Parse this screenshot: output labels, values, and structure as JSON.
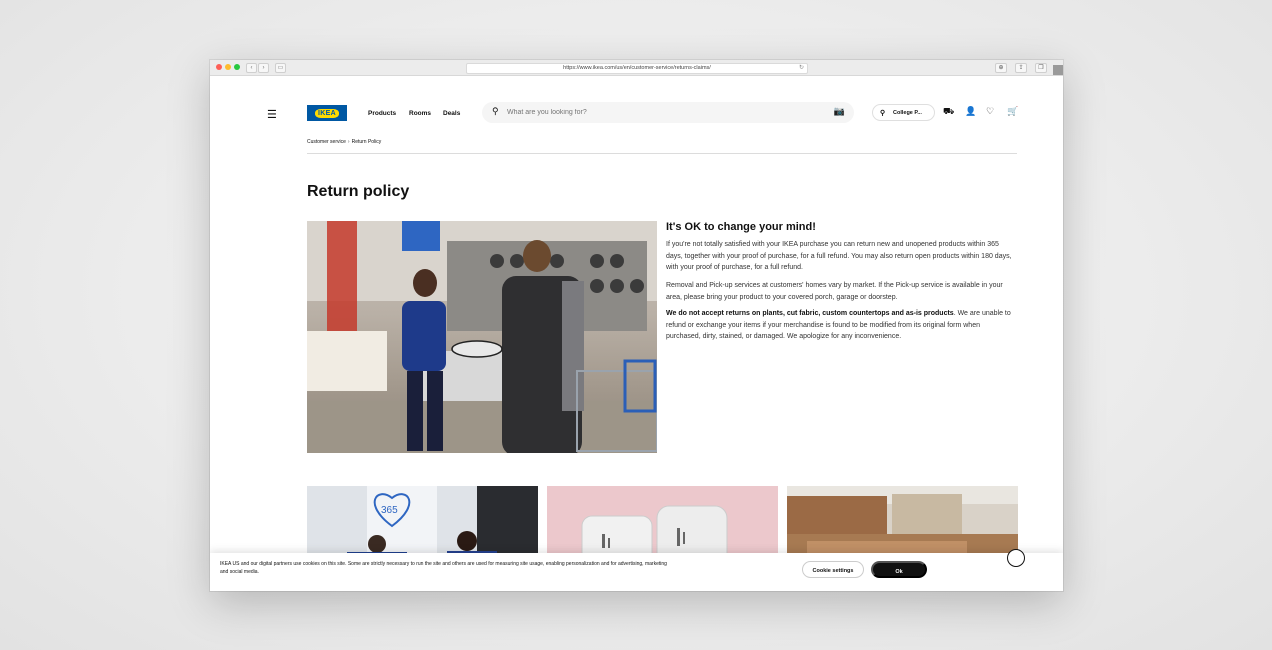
{
  "browser": {
    "url": "https://www.ikea.com/us/en/customer-service/returns-claims/",
    "nav_back": "‹",
    "nav_forward": "›",
    "reload": "↻"
  },
  "header": {
    "logo_text": "IKEA",
    "nav": [
      "Products",
      "Rooms",
      "Deals"
    ],
    "search_placeholder": "What are you looking for?",
    "store_label": "College P..."
  },
  "breadcrumb": {
    "items": [
      "Customer service",
      "Return Policy"
    ]
  },
  "main": {
    "title": "Return policy",
    "subheading": "It's OK to change your mind!",
    "para1": "If you're not totally satisfied with your IKEA purchase you can return new and unopened products within 365 days, together with your proof of purchase, for a full refund. You may also return open products within 180 days, with your proof of purchase, for a full refund.",
    "para2": "Removal and Pick-up services at customers' homes vary by market. If the Pick-up service is available in your area, please bring your product to your covered porch, garage or doorstep.",
    "para3_bold": "We do not accept returns on plants, cut fabric, custom countertops and as-is products",
    "para3_rest": ". We are unable to refund or exchange your items if your merchandise is found to be modified from its original form when purchased, dirty, stained, or damaged. We apologize for any inconvenience."
  },
  "cards": {
    "card1_sign_text": "365"
  },
  "cookie_banner": {
    "text": "IKEA US and our digital partners use cookies on this site. Some are strictly necessary to run the site and others are used for measuring site usage, enabling personalization and for advertising, marketing and social media.",
    "settings_label": "Cookie settings",
    "ok_label": "Ok"
  },
  "colors": {
    "ikea_blue": "#0058a3",
    "ikea_yellow": "#ffdb00"
  }
}
